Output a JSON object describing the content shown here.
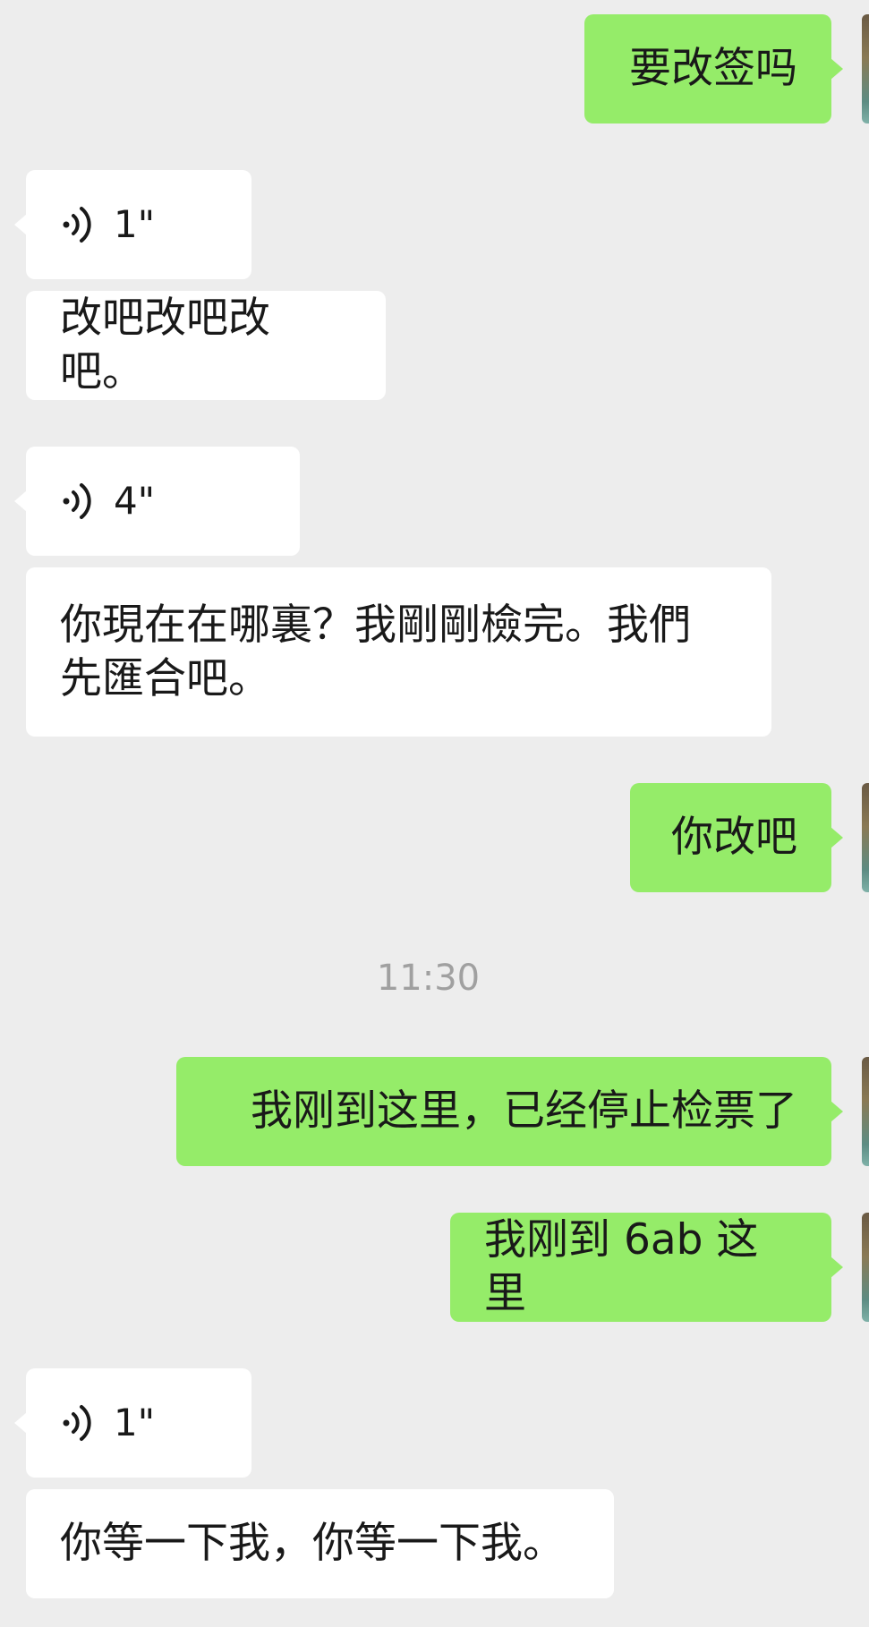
{
  "messages": [
    {
      "kind": "text",
      "direction": "out",
      "text": "要改签吗"
    },
    {
      "kind": "voice",
      "direction": "in",
      "duration": "1\"",
      "icon": "voice-wave-icon"
    },
    {
      "kind": "text",
      "direction": "in",
      "text": "改吧改吧改吧。"
    },
    {
      "kind": "voice",
      "direction": "in",
      "duration": "4\"",
      "icon": "voice-wave-icon"
    },
    {
      "kind": "text",
      "direction": "in",
      "line1": "你現在在哪裏？我剛剛檢完。我們",
      "line2": "先匯合吧。"
    },
    {
      "kind": "text",
      "direction": "out",
      "text": "你改吧"
    },
    {
      "kind": "time",
      "text": "11:30"
    },
    {
      "kind": "text",
      "direction": "out",
      "text": "我刚到这里，已经停止检票了"
    },
    {
      "kind": "text",
      "direction": "out",
      "text": "我刚到 6ab 这里"
    },
    {
      "kind": "voice",
      "direction": "in",
      "duration": "1\"",
      "icon": "voice-wave-icon"
    },
    {
      "kind": "text",
      "direction": "in",
      "text": "你等一下我，你等一下我。"
    }
  ],
  "colors": {
    "background": "#ededed",
    "incoming_bubble": "#ffffff",
    "outgoing_bubble": "#95ec69",
    "timestamp_text": "#a0a0a0"
  }
}
